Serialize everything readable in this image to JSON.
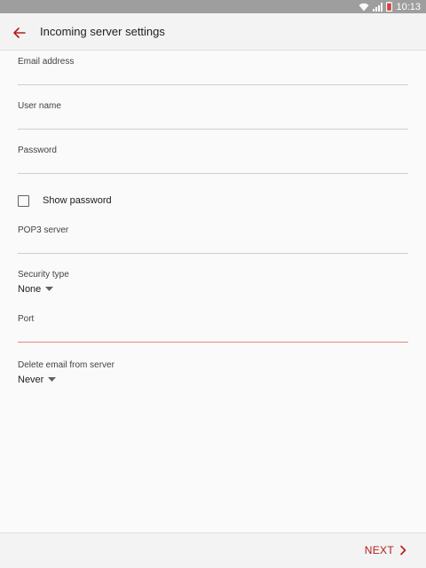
{
  "status_bar": {
    "time": "10:13",
    "icons": [
      "wifi-icon",
      "signal-icon",
      "battery-icon"
    ]
  },
  "app_bar": {
    "back_icon": "arrow-left-icon",
    "title": "Incoming server settings"
  },
  "form": {
    "email": {
      "label": "Email address",
      "value": ""
    },
    "username": {
      "label": "User name",
      "value": ""
    },
    "password": {
      "label": "Password",
      "value": ""
    },
    "show_password": {
      "label": "Show password",
      "checked": false
    },
    "pop3_server": {
      "label": "POP3 server",
      "value": ""
    },
    "security_type": {
      "label": "Security type",
      "value": "None"
    },
    "port": {
      "label": "Port",
      "value": ""
    },
    "delete_email": {
      "label": "Delete email from server",
      "value": "Never"
    }
  },
  "footer": {
    "next_label": "NEXT",
    "next_icon": "chevron-right-icon"
  },
  "colors": {
    "accent": "#b71c1c",
    "active_underline": "#e38a7c",
    "status_bar": "#9e9e9e",
    "background": "#fafafa"
  }
}
